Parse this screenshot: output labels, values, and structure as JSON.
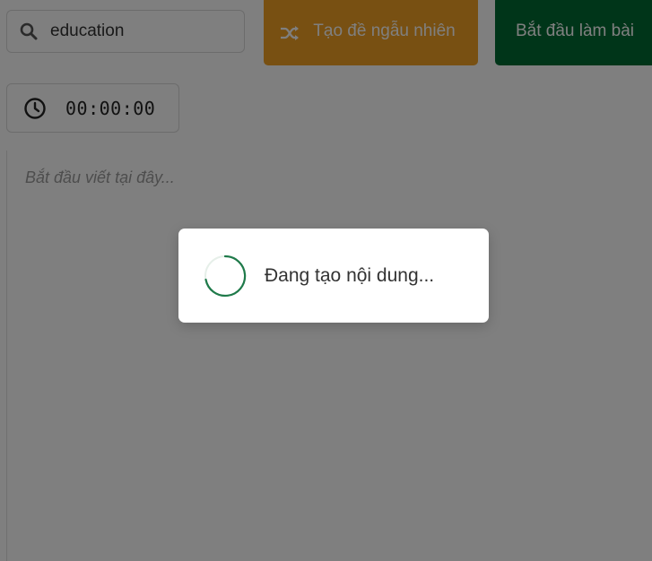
{
  "search": {
    "value": "education",
    "icon": "search-icon"
  },
  "toolbar": {
    "random_label": "Tạo đề ngẫu nhiên",
    "random_icon": "shuffle-icon",
    "start_label": "Bắt đầu làm bài"
  },
  "timer": {
    "icon": "clock-icon",
    "value": "00:00:00"
  },
  "editor": {
    "placeholder": "Bắt đầu viết tại đây..."
  },
  "loading": {
    "text": "Đang tạo nội dung..."
  },
  "colors": {
    "accent_orange": "#f0a024",
    "brand_green": "#006b33",
    "spinner_green": "#1f7a4a"
  }
}
